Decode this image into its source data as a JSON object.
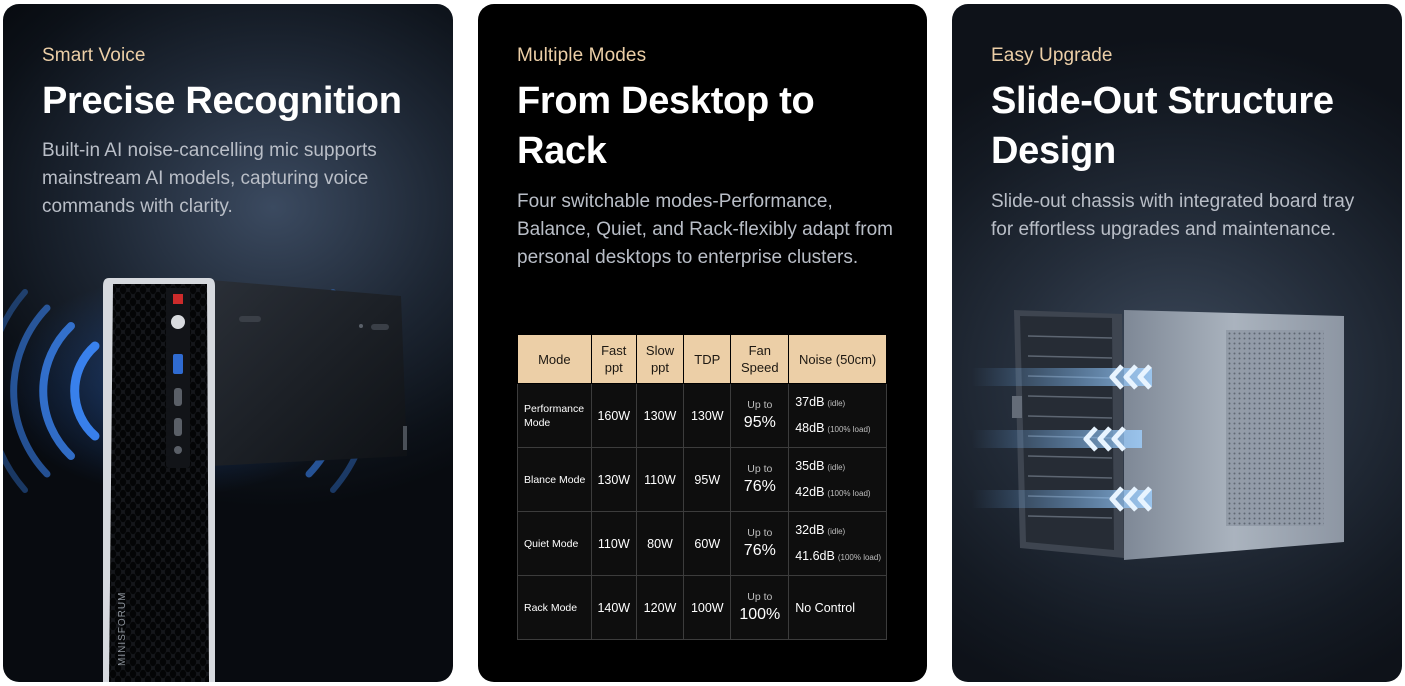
{
  "cards": [
    {
      "eyebrow": "Smart Voice",
      "title": "Precise Recognition",
      "description": "Built-in AI noise-cancelling mic supports mainstream AI models, capturing voice commands with clarity."
    },
    {
      "eyebrow": "Multiple Modes",
      "title": "From Desktop to Rack",
      "description": "Four switchable modes-Performance, Balance, Quiet, and Rack-flexibly adapt from personal desktops to enterprise clusters."
    },
    {
      "eyebrow": "Easy Upgrade",
      "title": "Slide-Out Structure Design",
      "description": "Slide-out chassis with integrated board tray for effortless upgrades and maintenance."
    }
  ],
  "table": {
    "headers": {
      "mode": "Mode",
      "fast_ppt": "Fast ppt",
      "slow_ppt": "Slow ppt",
      "tdp": "TDP",
      "fan_speed": "Fan Speed",
      "noise": "Noise (50cm)"
    },
    "rows": [
      {
        "mode": "Performance Mode",
        "fast": "160W",
        "slow": "130W",
        "tdp": "130W",
        "fan_prefix": "Up to",
        "fan": "95%",
        "noise_idle": "37dB",
        "idle_tag": "(idle)",
        "noise_load": "48dB",
        "load_tag": "(100% load)"
      },
      {
        "mode": "Blance Mode",
        "fast": "130W",
        "slow": "110W",
        "tdp": "95W",
        "fan_prefix": "Up to",
        "fan": "76%",
        "noise_idle": "35dB",
        "idle_tag": "(idle)",
        "noise_load": "42dB",
        "load_tag": "(100% load)"
      },
      {
        "mode": "Quiet Mode",
        "fast": "110W",
        "slow": "80W",
        "tdp": "60W",
        "fan_prefix": "Up to",
        "fan": "76%",
        "noise_idle": "32dB",
        "idle_tag": "(idle)",
        "noise_load": "41.6dB",
        "load_tag": "(100% load)"
      },
      {
        "mode": "Rack Mode",
        "fast": "140W",
        "slow": "120W",
        "tdp": "100W",
        "fan_prefix": "Up to",
        "fan": "100%",
        "noise_text": "No Control"
      }
    ]
  },
  "device_label": "MINISFORUM",
  "colors": {
    "accent": "#eccfa7",
    "card_dark": "#000000",
    "glow_blue": "#3f8cff"
  }
}
